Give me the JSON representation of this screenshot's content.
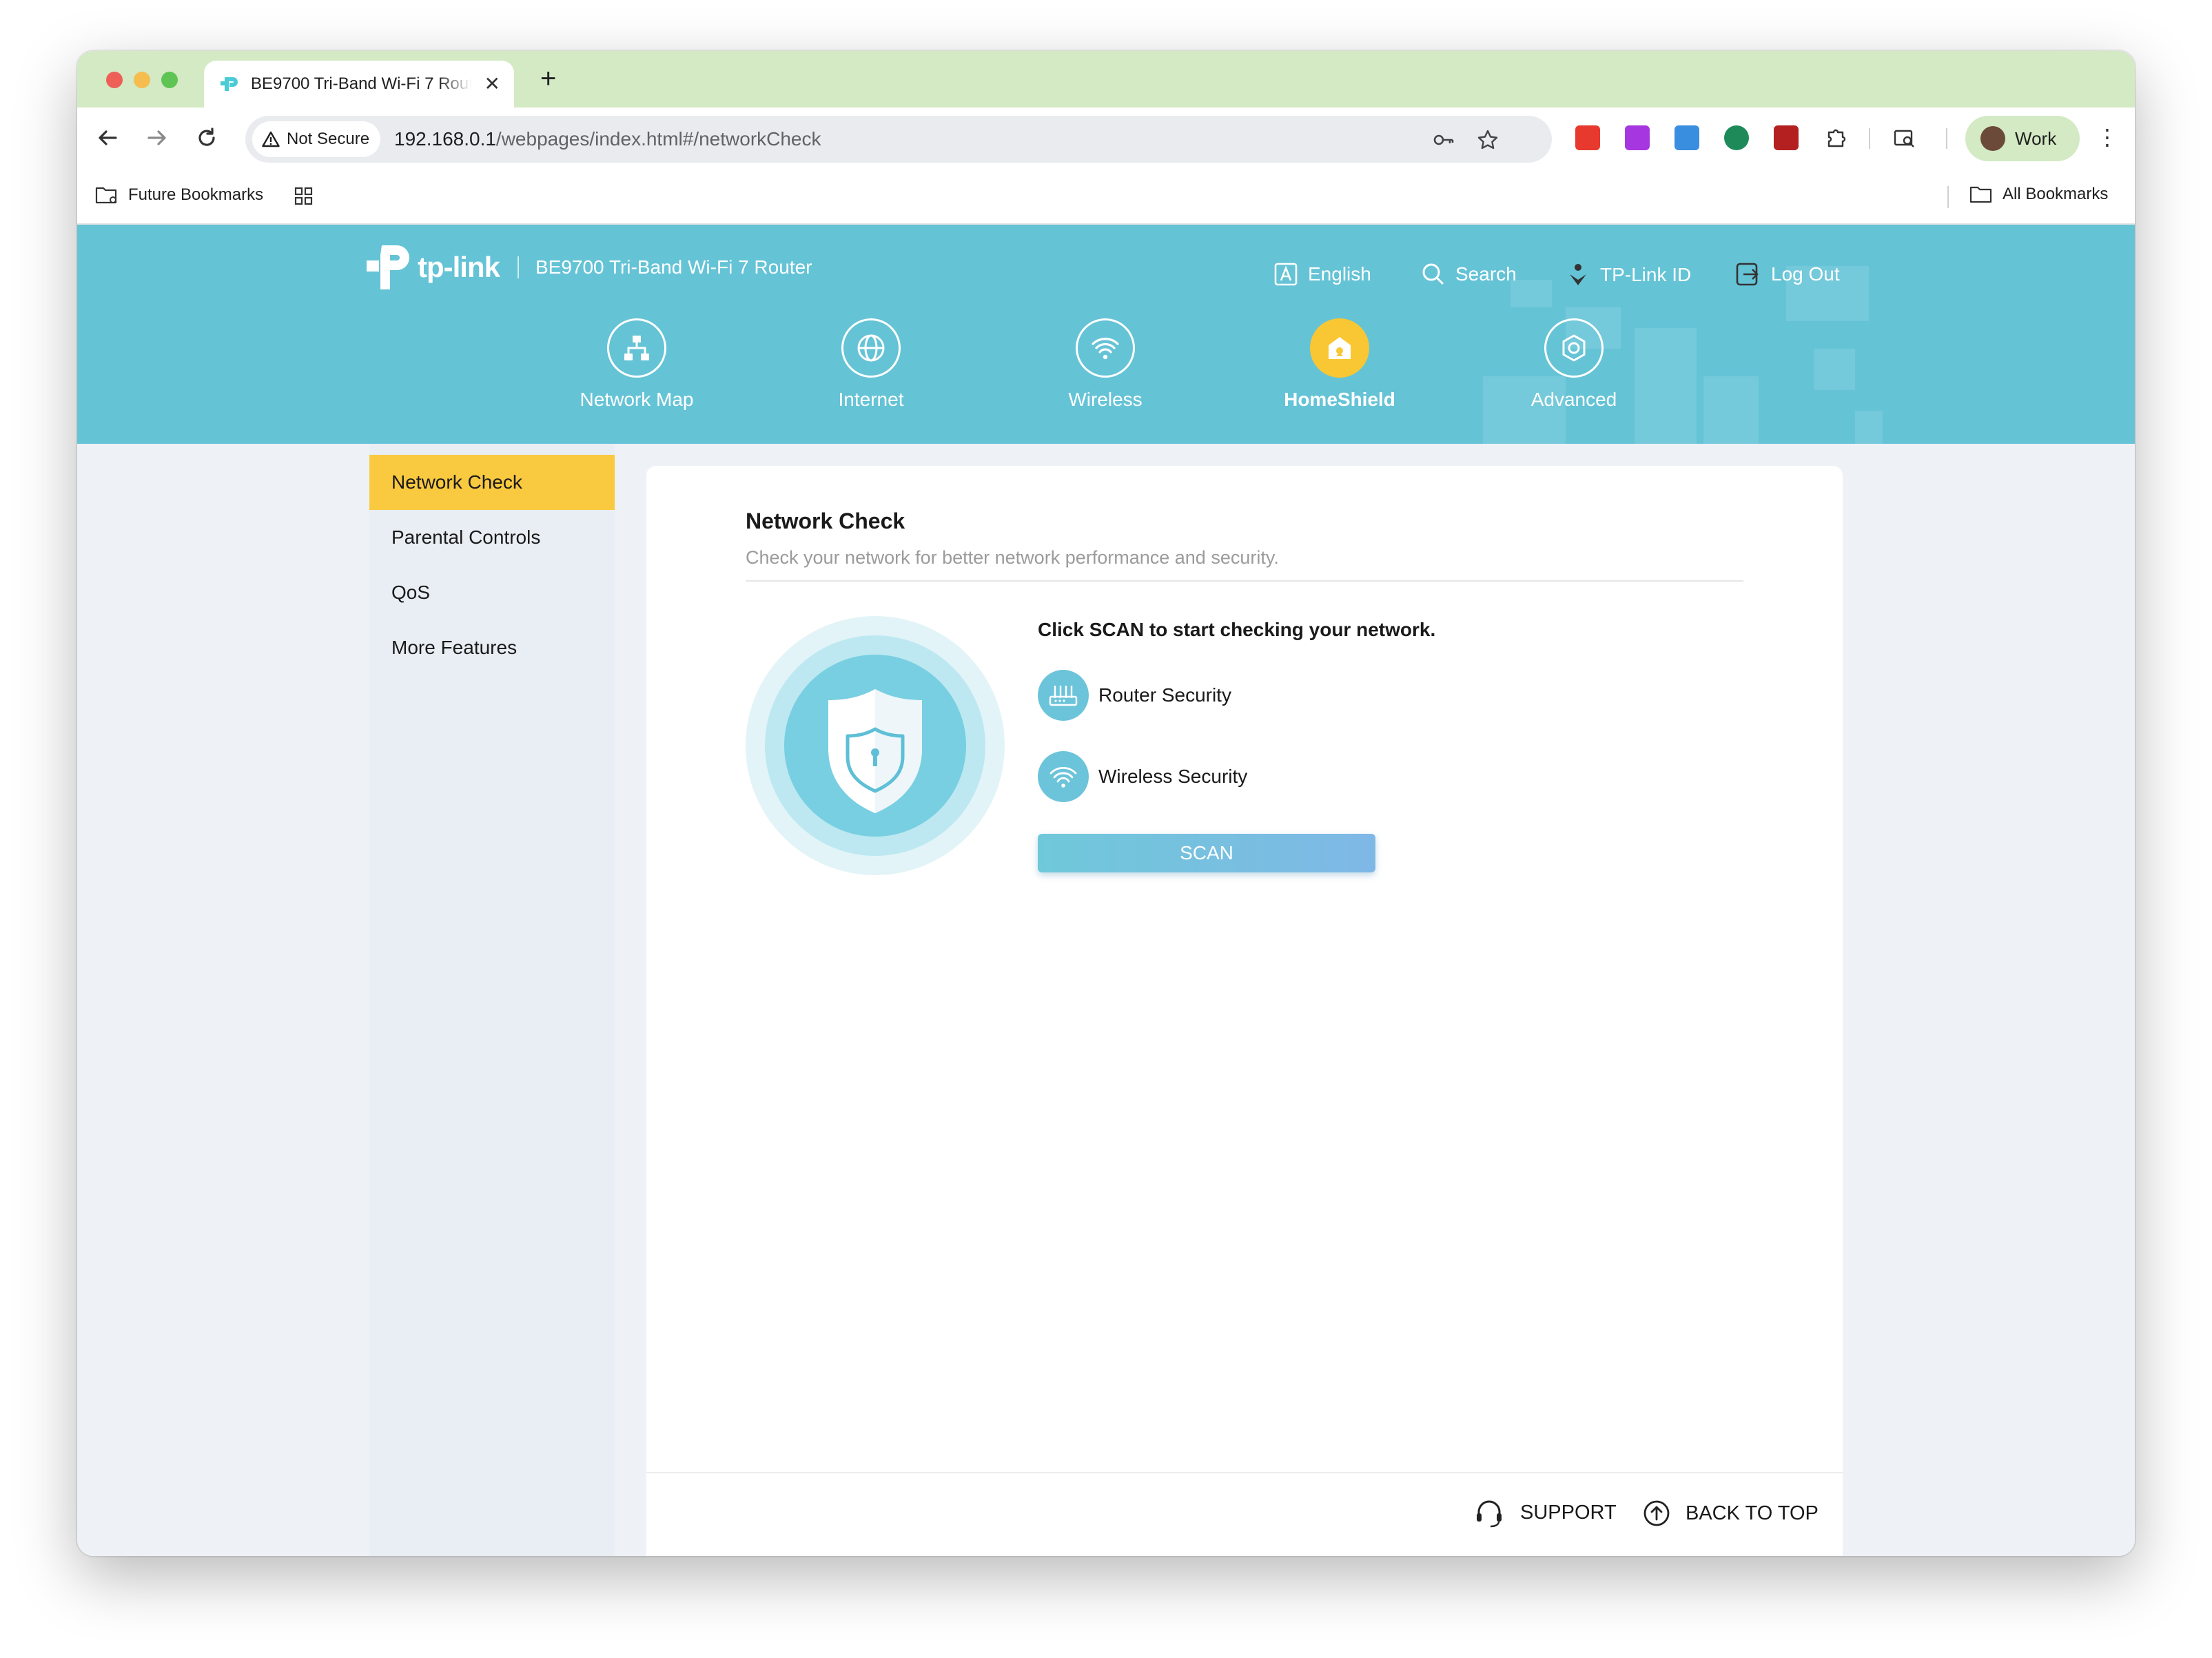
{
  "browser": {
    "tab_title": "BE9700 Tri-Band Wi-Fi 7 Router",
    "new_tab_label": "+",
    "tab_close_label": "✕",
    "security_label": "Not Secure",
    "url_host": "192.168.0.1",
    "url_path": "/webpages/index.html#/networkCheck",
    "profile_name": "Work",
    "bookmarks": {
      "folder_label": "Future Bookmarks",
      "all_label": "All Bookmarks"
    }
  },
  "router": {
    "brand": "tp-link",
    "model": "BE9700 Tri-Band Wi-Fi 7 Router",
    "utilities": {
      "language": "English",
      "search": "Search",
      "account": "TP-Link ID",
      "logout": "Log Out"
    },
    "nav": [
      {
        "label": "Network Map",
        "icon": "network-map-icon",
        "active": false
      },
      {
        "label": "Internet",
        "icon": "globe-icon",
        "active": false
      },
      {
        "label": "Wireless",
        "icon": "wifi-icon",
        "active": false
      },
      {
        "label": "HomeShield",
        "icon": "homeshield-icon",
        "active": true
      },
      {
        "label": "Advanced",
        "icon": "advanced-gear-icon",
        "active": false
      }
    ],
    "sidebar": [
      {
        "label": "Network Check",
        "active": true
      },
      {
        "label": "Parental Controls",
        "active": false
      },
      {
        "label": "QoS",
        "active": false
      },
      {
        "label": "More Features",
        "active": false
      }
    ],
    "content": {
      "title": "Network Check",
      "subtitle": "Check your network for better network performance and security.",
      "instruction": "Click SCAN to start checking your network.",
      "checks": [
        {
          "label": "Router Security",
          "icon": "router-icon"
        },
        {
          "label": "Wireless Security",
          "icon": "wifi-icon"
        }
      ],
      "scan_button": "SCAN"
    },
    "footer": {
      "support": "SUPPORT",
      "back_to_top": "BACK TO TOP"
    }
  },
  "colors": {
    "header_teal": "#65c3d6",
    "active_yellow": "#f9c940",
    "chrome_green": "#d3eac4"
  }
}
